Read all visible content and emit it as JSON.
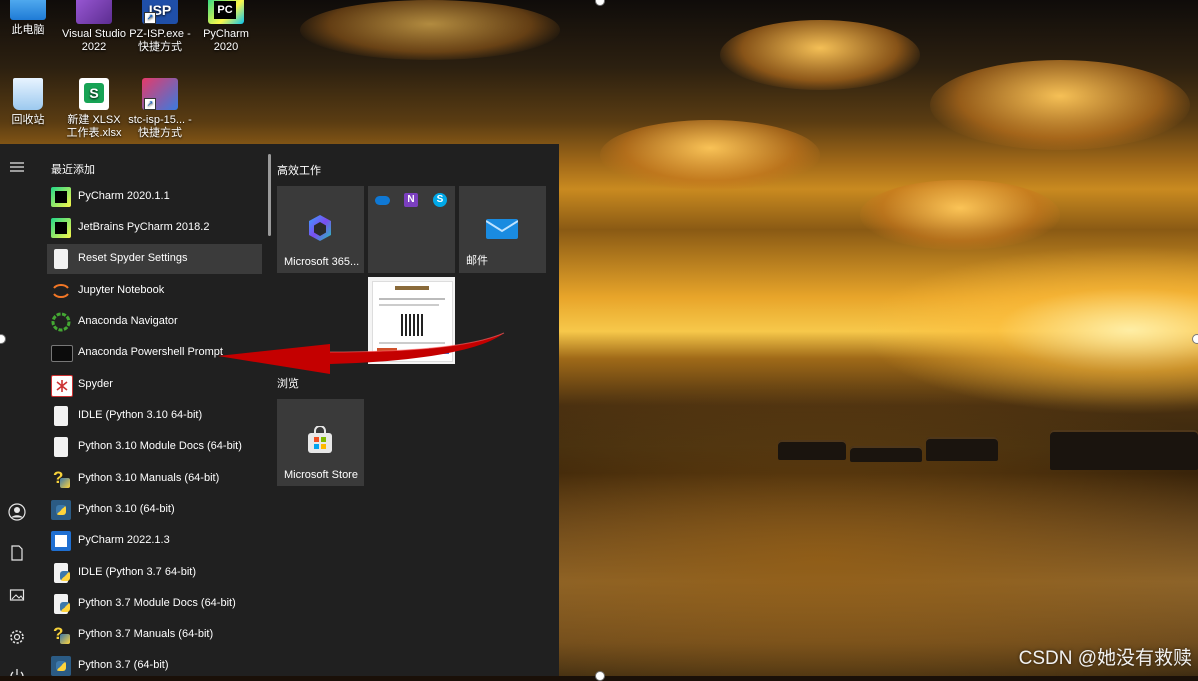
{
  "desktop": {
    "icons": [
      {
        "label": "此电脑",
        "icon": "this-pc-icon"
      },
      {
        "label": "Visual Studio 2022",
        "icon": "visual-studio-icon"
      },
      {
        "label": "PZ-ISP.exe - 快捷方式",
        "icon": "pz-isp-icon",
        "icon_text": "ISP"
      },
      {
        "label": "PyCharm 2020",
        "icon": "pycharm-icon",
        "icon_text": "PC"
      },
      {
        "label": "回收站",
        "icon": "recycle-bin-icon"
      },
      {
        "label": "新建 XLSX 工作表.xlsx",
        "icon": "xlsx-file-icon",
        "icon_text": "S"
      },
      {
        "label": "stc-isp-15... - 快捷方式",
        "icon": "stc-isp-icon"
      }
    ]
  },
  "start_menu": {
    "recent_header": "最近添加",
    "apps": [
      {
        "label": "PyCharm 2020.1.1",
        "icon": "pycharm-icon",
        "selected": false
      },
      {
        "label": "JetBrains PyCharm 2018.2",
        "icon": "pycharm-icon",
        "selected": false
      },
      {
        "label": "Reset Spyder Settings",
        "icon": "file-icon",
        "selected": true
      },
      {
        "label": "Jupyter Notebook",
        "icon": "jupyter-icon",
        "selected": false
      },
      {
        "label": "Anaconda Navigator",
        "icon": "anaconda-icon",
        "selected": false
      },
      {
        "label": "Anaconda Powershell Prompt",
        "icon": "terminal-icon",
        "selected": false
      },
      {
        "label": "Spyder",
        "icon": "spyder-icon",
        "selected": false
      },
      {
        "label": "IDLE (Python 3.10 64-bit)",
        "icon": "file-icon",
        "selected": false
      },
      {
        "label": "Python 3.10 Module Docs (64-bit)",
        "icon": "file-icon",
        "selected": false
      },
      {
        "label": "Python 3.10 Manuals (64-bit)",
        "icon": "python-help-icon",
        "selected": false
      },
      {
        "label": "Python 3.10 (64-bit)",
        "icon": "python-icon",
        "selected": false
      },
      {
        "label": "PyCharm 2022.1.3",
        "icon": "pycharm-icon",
        "selected": false
      },
      {
        "label": "IDLE (Python 3.7 64-bit)",
        "icon": "python-file-icon",
        "selected": false
      },
      {
        "label": "Python 3.7 Module Docs (64-bit)",
        "icon": "python-file-icon",
        "selected": false
      },
      {
        "label": "Python 3.7 Manuals (64-bit)",
        "icon": "python-help-icon",
        "selected": false
      },
      {
        "label": "Python 3.7 (64-bit)",
        "icon": "python-icon",
        "selected": false
      }
    ],
    "groups": {
      "productivity_title": "高效工作",
      "browse_title": "浏览"
    },
    "tiles": {
      "m365": {
        "label": "Microsoft 365...",
        "icon": "microsoft-365-icon"
      },
      "office_folder": {
        "icons": [
          "onedrive-icon",
          "onenote-icon",
          "skype-icon"
        ]
      },
      "mail": {
        "label": "邮件",
        "icon": "mail-icon"
      },
      "photo": {
        "icon": "document-thumbnail-icon"
      },
      "store": {
        "label": "Microsoft Store",
        "icon": "store-icon"
      }
    },
    "rail": [
      "user-icon",
      "documents-icon",
      "pictures-icon",
      "settings-icon",
      "power-icon"
    ]
  },
  "watermark": "CSDN @她没有救赎",
  "colors": {
    "menu_bg": "#202020",
    "tile_bg": "#3a3a3a",
    "selected_bg": "#3b3b3b",
    "arrow": "#c40000"
  }
}
